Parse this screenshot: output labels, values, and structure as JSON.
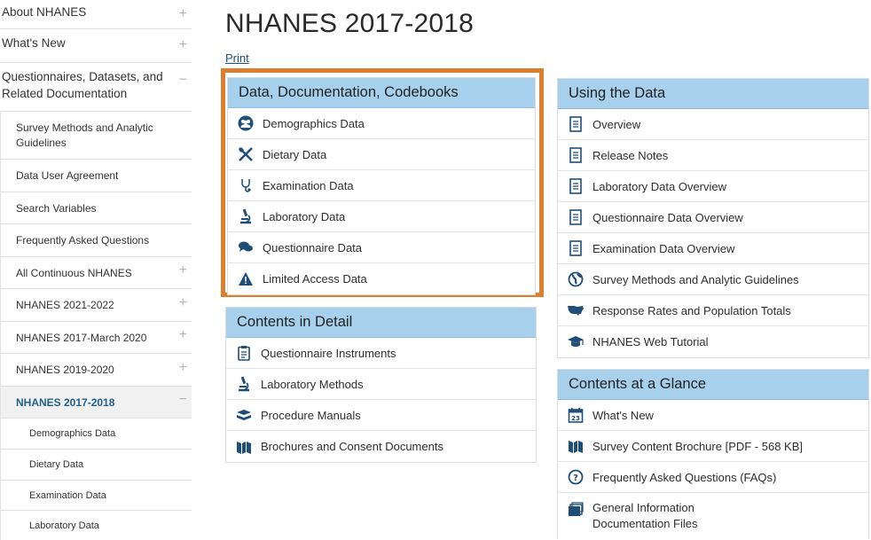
{
  "sidebar": {
    "top_items": [
      {
        "label": "About NHANES",
        "sign": "+"
      },
      {
        "label": "What's New",
        "sign": "+"
      },
      {
        "label": "Questionnaires, Datasets, and Related Documentation",
        "sign": "−"
      }
    ],
    "sub_items": [
      {
        "label": "Survey Methods and Analytic Guidelines",
        "sign": ""
      },
      {
        "label": "Data User Agreement",
        "sign": ""
      },
      {
        "label": "Search Variables",
        "sign": ""
      },
      {
        "label": "Frequently Asked Questions",
        "sign": ""
      },
      {
        "label": "All Continuous NHANES",
        "sign": "+"
      },
      {
        "label": "NHANES 2021-2022",
        "sign": "+"
      },
      {
        "label": "NHANES 2017-March 2020",
        "sign": "+"
      },
      {
        "label": "NHANES 2019-2020",
        "sign": "+"
      },
      {
        "label": "NHANES 2017-2018",
        "sign": "−"
      }
    ],
    "nested_items": [
      {
        "label": "Demographics Data"
      },
      {
        "label": "Dietary Data"
      },
      {
        "label": "Examination Data"
      },
      {
        "label": "Laboratory Data"
      }
    ]
  },
  "main": {
    "title": "NHANES 2017-2018",
    "print_label": "Print"
  },
  "panels": {
    "data_docs": {
      "title": "Data, Documentation, Codebooks",
      "items": [
        {
          "label": "Demographics Data",
          "icon": "people-icon"
        },
        {
          "label": "Dietary Data",
          "icon": "utensils-icon"
        },
        {
          "label": "Examination Data",
          "icon": "stethoscope-icon"
        },
        {
          "label": "Laboratory Data",
          "icon": "microscope-icon"
        },
        {
          "label": "Questionnaire Data",
          "icon": "speech-bubbles-icon"
        },
        {
          "label": "Limited Access Data",
          "icon": "warning-icon"
        }
      ]
    },
    "contents_detail": {
      "title": "Contents in Detail",
      "items": [
        {
          "label": "Questionnaire Instruments",
          "icon": "clipboard-icon"
        },
        {
          "label": "Laboratory Methods",
          "icon": "microscope-icon"
        },
        {
          "label": "Procedure Manuals",
          "icon": "book-stack-icon"
        },
        {
          "label": "Brochures and Consent Documents",
          "icon": "map-fold-icon"
        }
      ]
    },
    "using_data": {
      "title": "Using the Data",
      "items": [
        {
          "label": "Overview",
          "icon": "document-icon"
        },
        {
          "label": "Release Notes",
          "icon": "document-icon"
        },
        {
          "label": "Laboratory Data Overview",
          "icon": "document-icon"
        },
        {
          "label": "Questionnaire Data Overview",
          "icon": "document-icon"
        },
        {
          "label": "Examination Data Overview",
          "icon": "document-icon"
        },
        {
          "label": "Survey Methods and Analytic Guidelines",
          "icon": "globe-icon"
        },
        {
          "label": "Response Rates and Population Totals",
          "icon": "usa-map-icon"
        },
        {
          "label": "NHANES Web Tutorial",
          "icon": "graduation-cap-icon"
        }
      ]
    },
    "at_a_glance": {
      "title": "Contents at a Glance",
      "items": [
        {
          "label": "What's New",
          "icon": "calendar-icon",
          "badge": "23"
        },
        {
          "label": "Survey Content Brochure [PDF - 568 KB]",
          "icon": "map-fold-icon"
        },
        {
          "label": "Frequently Asked Questions (FAQs)",
          "icon": "question-circle-icon"
        },
        {
          "label": "General Information",
          "icon": "folders-icon"
        },
        {
          "label": "Documentation Files",
          "icon": ""
        }
      ]
    }
  },
  "colors": {
    "panel_header_bg": "#a6d0ec",
    "highlight_border": "#dc7f2d",
    "icon_blue": "#1f4e79",
    "active_link": "#21618c"
  }
}
